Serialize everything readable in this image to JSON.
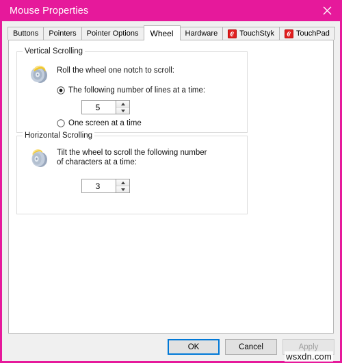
{
  "window": {
    "title": "Mouse Properties",
    "close_icon": "close-icon",
    "accent_color": "#e6199b",
    "body_color": "#f0f0f0"
  },
  "tabs": [
    {
      "label": "Buttons",
      "icon": null,
      "active": false
    },
    {
      "label": "Pointers",
      "icon": null,
      "active": false
    },
    {
      "label": "Pointer Options",
      "icon": null,
      "active": false
    },
    {
      "label": "Wheel",
      "icon": null,
      "active": true
    },
    {
      "label": "Hardware",
      "icon": null,
      "active": false
    },
    {
      "label": "TouchStyk",
      "icon": "touchstyk-icon",
      "active": false
    },
    {
      "label": "TouchPad",
      "icon": "touchpad-icon",
      "active": false
    }
  ],
  "wheel_page": {
    "vertical": {
      "group_label": "Vertical Scrolling",
      "icon": "mouse-wheel-vertical-icon",
      "description": "Roll the wheel one notch to scroll:",
      "option_lines": {
        "label": "The following number of lines at a time:",
        "selected": true
      },
      "lines_value": "5",
      "option_screen": {
        "label": "One screen at a time",
        "selected": false
      }
    },
    "horizontal": {
      "group_label": "Horizontal Scrolling",
      "icon": "mouse-wheel-horizontal-icon",
      "description": "Tilt the wheel to scroll the following number\nof characters at a time:",
      "characters_value": "3"
    }
  },
  "footer": {
    "ok_label": "OK",
    "cancel_label": "Cancel",
    "apply_label": "Apply",
    "apply_enabled": false
  },
  "watermark": {
    "text": "wsxdn.com"
  }
}
